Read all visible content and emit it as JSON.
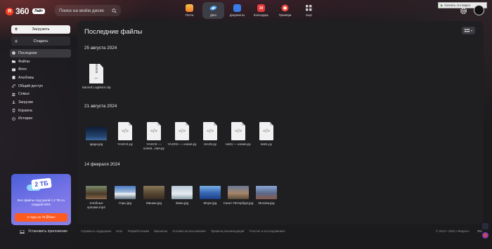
{
  "brand": {
    "ya": "Я",
    "name": "360",
    "tier": "Лайт"
  },
  "search": {
    "placeholder": "Поиск на моём диске"
  },
  "apps": [
    {
      "label": "Почта",
      "color": "#f0a03a",
      "badge": ""
    },
    {
      "label": "Диск",
      "color": "#3a8ee6",
      "badge": "",
      "active": true
    },
    {
      "label": "Документы",
      "color": "#3a7ce6",
      "badge": ""
    },
    {
      "label": "Календарь",
      "color": "#e6393a",
      "badge": "19"
    },
    {
      "label": "Премиум",
      "color": "#e64a3a",
      "badge": ""
    },
    {
      "label": "Ещё",
      "color": "#cfcfcf",
      "badge": ""
    }
  ],
  "browser_strip": "Скачать это видео",
  "sidebar": {
    "upload_label": "Загрузить",
    "create_label": "Создать",
    "items": [
      {
        "label": "Последние",
        "active": true
      },
      {
        "label": "Файлы"
      },
      {
        "label": "Фото"
      },
      {
        "label": "Альбомы"
      },
      {
        "label": "Общий доступ"
      },
      {
        "label": "Семья"
      },
      {
        "label": "Загрузки"
      },
      {
        "label": "Корзина"
      },
      {
        "label": "История"
      }
    ],
    "promo": {
      "badge": "2 ТБ",
      "text": "Все файлы под рукой с 2 ТБ со скидкой 60%",
      "button": "2 года за 76 ₽/мес"
    },
    "install_label": "Установить приложение"
  },
  "main": {
    "title": "Последние файлы",
    "sections": [
      {
        "date": "25 августа 2024",
        "files": [
          {
            "name": "Sacred Logistics.zip",
            "kind": "zip"
          }
        ]
      },
      {
        "date": "21 августа 2024",
        "files": [
          {
            "name": "igaga.jpg",
            "kind": "photo",
            "colors": [
              "#1a2a4a",
              "#2f4f7a"
            ]
          },
          {
            "name": "YAzICK.py",
            "kind": "code"
          },
          {
            "name": "YAzICK — копия...пия.py",
            "kind": "code"
          },
          {
            "name": "YAzICK — копия.py",
            "kind": "code"
          },
          {
            "name": "UHJS.py",
            "kind": "code"
          },
          {
            "name": "test1 — копия.py",
            "kind": "code"
          },
          {
            "name": "test1.py",
            "kind": "code"
          }
        ]
      },
      {
        "date": "14 февраля 2024",
        "files": [
          {
            "name": "Хлебные крошки.mp4",
            "kind": "photo",
            "colors": [
              "#5a4a3a",
              "#8a7a5a"
            ]
          },
          {
            "name": "Горы.jpg",
            "kind": "photo",
            "colors": [
              "#5a86c6",
              "#d9e3ee"
            ]
          },
          {
            "name": "Мишки.jpg",
            "kind": "photo",
            "colors": [
              "#6a5a44",
              "#3a2e24"
            ]
          },
          {
            "name": "Зима.jpg",
            "kind": "photo",
            "colors": [
              "#aab6c6",
              "#eef2f6"
            ]
          },
          {
            "name": "Море.jpg",
            "kind": "photo",
            "colors": [
              "#2a56a6",
              "#8ab4e6"
            ]
          },
          {
            "name": "Санкт-Петербург.jpg",
            "kind": "photo",
            "colors": [
              "#9a7a5a",
              "#4a5a7a"
            ]
          },
          {
            "name": "Москва.jpg",
            "kind": "photo",
            "colors": [
              "#4a5a7a",
              "#a6b6d6"
            ]
          }
        ]
      }
    ]
  },
  "footer": {
    "links": [
      "Справка и поддержка",
      "Блог",
      "Разработчикам",
      "Вакансии",
      "Условия использования",
      "Правила рекомендаций",
      "Участие в исследованиях"
    ],
    "copyright": "© 2012—2024 «Яндекс»",
    "lang": "RU"
  }
}
